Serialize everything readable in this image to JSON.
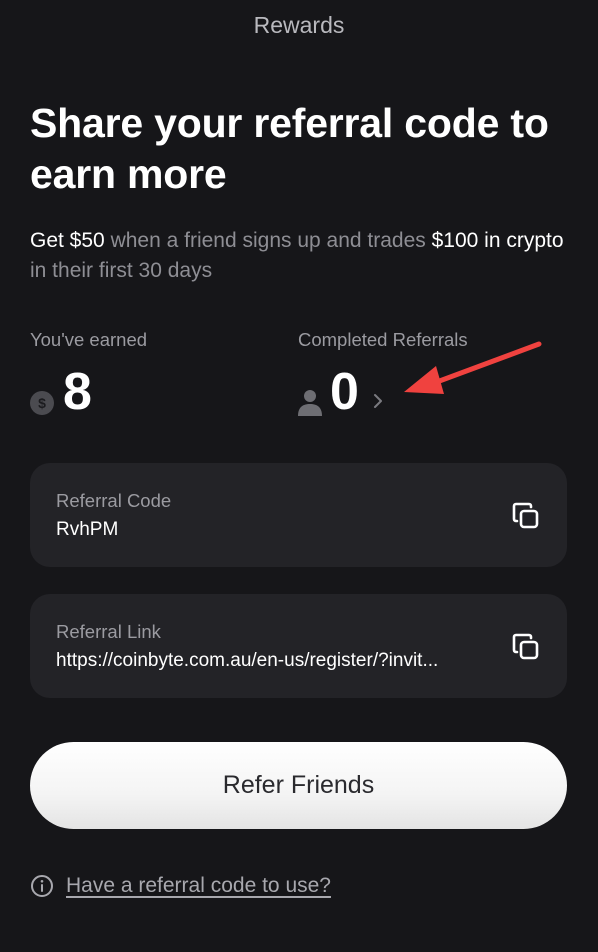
{
  "header": {
    "title": "Rewards"
  },
  "hero": {
    "headline": "Share your referral code to earn more",
    "sub_1": "Get $50",
    "sub_2": " when a friend signs up and trades ",
    "sub_3": "$100 in crypto",
    "sub_4": " in their first 30 days"
  },
  "stats": {
    "earned_label": "You've earned",
    "earned_value": "8",
    "referrals_label": "Completed Referrals",
    "referrals_value": "0"
  },
  "referral_code": {
    "label": "Referral Code",
    "value": "RvhPM"
  },
  "referral_link": {
    "label": "Referral Link",
    "value": "https://coinbyte.com.au/en-us/register/?invit..."
  },
  "refer_button": {
    "label": "Refer Friends"
  },
  "footer": {
    "link_label": "Have a referral code to use?"
  },
  "colors": {
    "background": "#161619",
    "card": "#232327",
    "annotation_arrow": "#f0423f"
  },
  "icons": [
    "dollar-icon",
    "person-icon",
    "chevron-right-icon",
    "copy-icon",
    "info-icon"
  ]
}
